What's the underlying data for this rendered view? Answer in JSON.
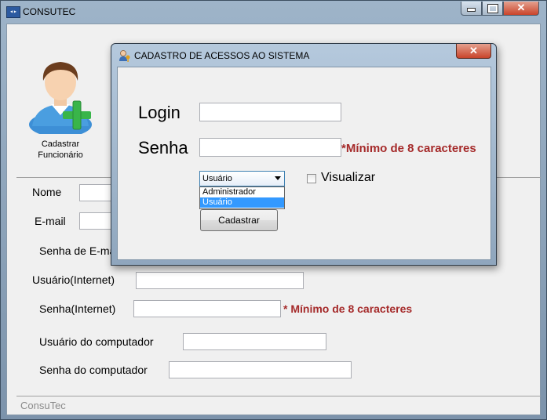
{
  "main_window": {
    "title": "CONSUTEC",
    "close_glyph": "✕"
  },
  "sidebar": {
    "cadastrar_label_line1": "Cadastrar",
    "cadastrar_label_line2": "Funcionário"
  },
  "form": {
    "nome_label": "Nome",
    "email_label": "E-mail",
    "senha_email_label": "Senha de E-mail",
    "usuario_internet_label": "Usuário(Internet)",
    "senha_internet_label": "Senha(Internet)",
    "senha_internet_warning": "* Mínimo de 8 caracteres",
    "usuario_computador_label": "Usuário do computador",
    "senha_computador_label": "Senha do computador"
  },
  "footer": {
    "text": "ConsuTec"
  },
  "dialog": {
    "title": "CADASTRO DE ACESSOS AO SISTEMA",
    "close_glyph": "✕",
    "login_label": "Login",
    "login_value": "",
    "senha_label": "Senha",
    "senha_value": "",
    "senha_warning": "*Mínimo de 8 caracteres",
    "role_select": {
      "selected": "Usuário",
      "options": [
        "Administrador",
        "Usuário"
      ]
    },
    "visualizar_label": "Visualizar",
    "cadastrar_button": "Cadastrar"
  },
  "colors": {
    "warning": "#a52a2a",
    "selection": "#3399ff"
  }
}
